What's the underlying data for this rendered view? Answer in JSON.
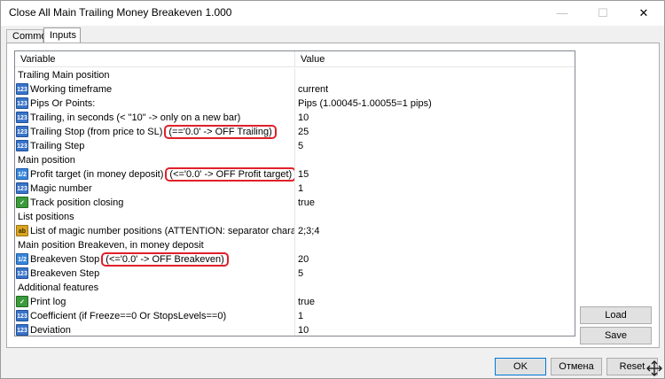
{
  "window": {
    "title": "Close All Main Trailing Money Breakeven 1.000",
    "minimize_glyph": "—",
    "maximize_glyph": "☐",
    "close_glyph": "✕"
  },
  "tabs": [
    {
      "label": "Common",
      "active": false
    },
    {
      "label": "Inputs",
      "active": true
    }
  ],
  "grid": {
    "columns": {
      "variable": "Variable",
      "value": "Value"
    },
    "rows": [
      {
        "kind": "group",
        "label": "Trailing Main position",
        "value": ""
      },
      {
        "kind": "item",
        "icon": "int",
        "icon_text": "123",
        "label": "Working timeframe",
        "note": "",
        "value": "current"
      },
      {
        "kind": "item",
        "icon": "int",
        "icon_text": "123",
        "label": "Pips Or Points:",
        "note": "",
        "value": "Pips (1.00045-1.00055=1 pips)"
      },
      {
        "kind": "item",
        "icon": "int",
        "icon_text": "123",
        "label": "Trailing, in seconds (< \"10\" -> only on a new bar)",
        "note": "",
        "value": "10"
      },
      {
        "kind": "item",
        "icon": "int",
        "icon_text": "123",
        "label": "Trailing Stop (from price to SL)",
        "note": "(=='0.0' -> OFF Trailing)",
        "value": "25"
      },
      {
        "kind": "item",
        "icon": "int",
        "icon_text": "123",
        "label": "Trailing Step",
        "note": "",
        "value": "5"
      },
      {
        "kind": "group",
        "label": "Main position",
        "value": ""
      },
      {
        "kind": "item",
        "icon": "dbl",
        "icon_text": "1/2",
        "label": "Profit target (in money deposit)",
        "note": "(<='0.0' -> OFF Profit target)",
        "value": "15"
      },
      {
        "kind": "item",
        "icon": "int",
        "icon_text": "123",
        "label": "Magic number",
        "note": "",
        "value": "1"
      },
      {
        "kind": "item",
        "icon": "bool",
        "icon_text": "✓",
        "label": "Track position closing",
        "note": "",
        "value": "true"
      },
      {
        "kind": "group",
        "label": "List positions",
        "value": ""
      },
      {
        "kind": "item",
        "icon": "str",
        "icon_text": "ab",
        "label": "List of magic number positions (ATTENTION: separator character",
        "note": "",
        "value": "2;3;4"
      },
      {
        "kind": "group",
        "label": "Main position Breakeven, in money deposit",
        "value": ""
      },
      {
        "kind": "item",
        "icon": "dbl",
        "icon_text": "1/2",
        "label": "Breakeven Stop",
        "note": "(<='0.0' -> OFF Breakeven)",
        "value": "20"
      },
      {
        "kind": "item",
        "icon": "int",
        "icon_text": "123",
        "label": "Breakeven Step",
        "note": "",
        "value": "5"
      },
      {
        "kind": "group",
        "label": "Additional features",
        "value": ""
      },
      {
        "kind": "item",
        "icon": "bool",
        "icon_text": "✓",
        "label": "Print log",
        "note": "",
        "value": "true"
      },
      {
        "kind": "item",
        "icon": "int",
        "icon_text": "123",
        "label": "Coefficient (if Freeze==0 Or StopsLevels==0)",
        "note": "",
        "value": "1"
      },
      {
        "kind": "item",
        "icon": "int",
        "icon_text": "123",
        "label": "Deviation",
        "note": "",
        "value": "10"
      }
    ]
  },
  "side_buttons": {
    "load": "Load",
    "save": "Save"
  },
  "footer_buttons": {
    "ok": "OK",
    "cancel": "Отмена",
    "reset": "Reset"
  },
  "colors": {
    "highlight": "#e0202a",
    "accent": "#0078d7"
  }
}
